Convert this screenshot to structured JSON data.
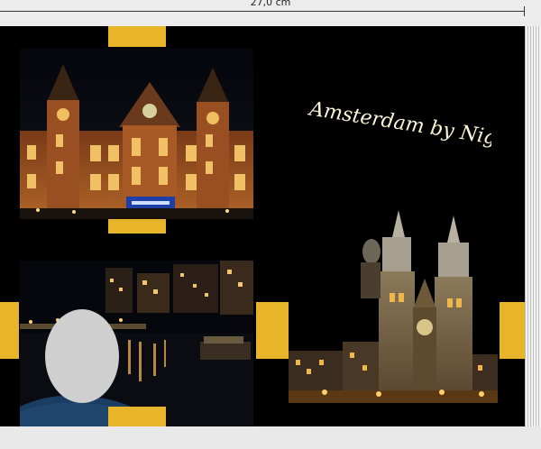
{
  "ruler": {
    "width_label": "27,0 cm"
  },
  "album_page": {
    "title": "Amsterdam by Night",
    "background_color": "#000000",
    "accent_color": "#E8B52A"
  },
  "photos": [
    {
      "name": "amsterdam-central-station",
      "subject": "Centraal Station at night"
    },
    {
      "name": "amsterdam-canal-night",
      "subject": "canal with city lights"
    },
    {
      "name": "st-nicholas-church",
      "subject": "Basilica of St. Nicholas at night"
    }
  ],
  "icons": [
    "face-placeholder-icon"
  ]
}
